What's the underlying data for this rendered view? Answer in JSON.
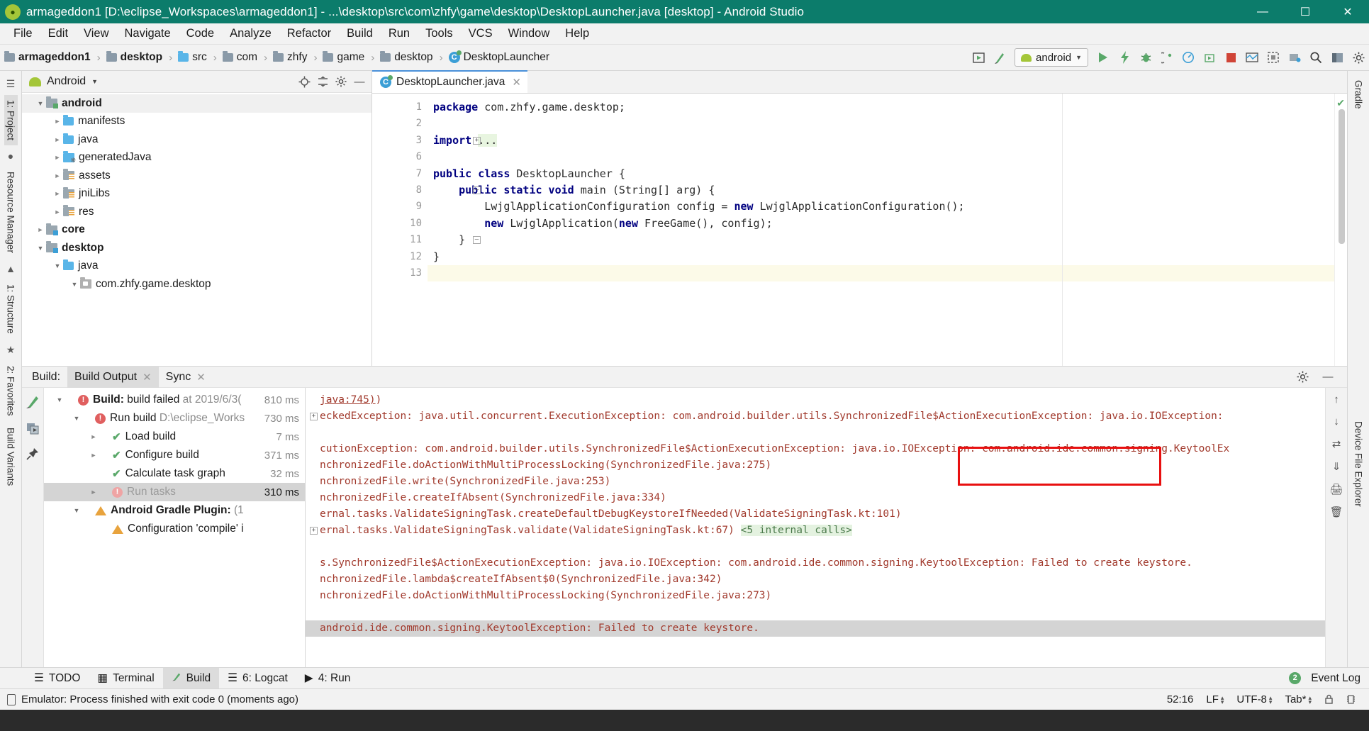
{
  "window": {
    "title": "armageddon1 [D:\\eclipse_Workspaces\\armageddon1] - ...\\desktop\\src\\com\\zhfy\\game\\desktop\\DesktopLauncher.java [desktop] - Android Studio",
    "app_icon": "android-studio-icon",
    "minimize": "—",
    "maximize": "☐",
    "close": "✕"
  },
  "menubar": {
    "items": [
      {
        "label": "File"
      },
      {
        "label": "Edit"
      },
      {
        "label": "View"
      },
      {
        "label": "Navigate"
      },
      {
        "label": "Code"
      },
      {
        "label": "Analyze"
      },
      {
        "label": "Refactor"
      },
      {
        "label": "Build"
      },
      {
        "label": "Run"
      },
      {
        "label": "Tools"
      },
      {
        "label": "VCS"
      },
      {
        "label": "Window"
      },
      {
        "label": "Help"
      }
    ]
  },
  "toolbar": {
    "breadcrumb": [
      {
        "label": "armageddon1",
        "icon": "module-folder-icon",
        "bold": true
      },
      {
        "label": "desktop",
        "icon": "module-folder-icon",
        "bold": true
      },
      {
        "label": "src",
        "icon": "source-folder-icon",
        "bold": false
      },
      {
        "label": "com",
        "icon": "package-folder-icon",
        "bold": false
      },
      {
        "label": "zhfy",
        "icon": "package-folder-icon",
        "bold": false
      },
      {
        "label": "game",
        "icon": "package-folder-icon",
        "bold": false
      },
      {
        "label": "desktop",
        "icon": "package-folder-icon",
        "bold": false
      },
      {
        "label": "DesktopLauncher",
        "icon": "java-class-icon",
        "bold": false
      }
    ],
    "separator": "›",
    "run_config": {
      "label": "android",
      "icon": "android-robot-icon",
      "caret": "▼"
    },
    "icons": [
      "avd-manager-icon",
      "sdk-manager-icon",
      "run-icon",
      "apply-changes-icon",
      "debug-icon",
      "attach-debugger-icon",
      "profiler-icon",
      "run-coverage-icon",
      "stop-icon",
      "layout-inspector-icon",
      "device-screenshot-icon",
      "device-file-explorer-icon",
      "search-icon",
      "project-structure-icon",
      "settings-icon"
    ]
  },
  "left_strip": {
    "tabs": [
      {
        "label": "1: Project",
        "selected": true
      },
      {
        "label": "Resource Manager",
        "selected": false
      },
      {
        "label": "1: Structure",
        "selected": false
      },
      {
        "label": "2: Favorites",
        "selected": false
      },
      {
        "label": "Build Variants",
        "selected": false
      }
    ]
  },
  "right_strip": {
    "tabs": [
      {
        "label": "Gradle"
      },
      {
        "label": "Device File Explorer"
      }
    ]
  },
  "project_panel": {
    "header": {
      "title": "Android",
      "caret": "▼",
      "icon": "android-robot-icon"
    },
    "header_icons": [
      "locate-icon",
      "collapse-all-icon",
      "settings-icon",
      "hide-icon"
    ],
    "tree": [
      {
        "label": "android",
        "depth": 0,
        "arrow": "open",
        "icon": "module-green-icon",
        "bold": true,
        "selected": true
      },
      {
        "label": "manifests",
        "depth": 1,
        "arrow": "closed",
        "icon": "folder-blue-icon",
        "bold": false
      },
      {
        "label": "java",
        "depth": 1,
        "arrow": "closed",
        "icon": "folder-blue-icon",
        "bold": false
      },
      {
        "label": "generatedJava",
        "depth": 1,
        "arrow": "closed",
        "icon": "generated-folder-icon",
        "bold": false
      },
      {
        "label": "assets",
        "depth": 1,
        "arrow": "closed",
        "icon": "resource-folder-icon",
        "bold": false
      },
      {
        "label": "jniLibs",
        "depth": 1,
        "arrow": "closed",
        "icon": "resource-folder-icon",
        "bold": false
      },
      {
        "label": "res",
        "depth": 1,
        "arrow": "closed",
        "icon": "resource-folder-icon",
        "bold": false
      },
      {
        "label": "core",
        "depth": 0,
        "arrow": "closed",
        "icon": "module-blue-icon",
        "bold": true
      },
      {
        "label": "desktop",
        "depth": 0,
        "arrow": "open",
        "icon": "module-blue-icon",
        "bold": true
      },
      {
        "label": "java",
        "depth": 1,
        "arrow": "open",
        "icon": "folder-blue-icon",
        "bold": false
      },
      {
        "label": "com.zhfy.game.desktop",
        "depth": 2,
        "arrow": "open",
        "icon": "package-icon",
        "bold": false
      }
    ]
  },
  "editor": {
    "tab": {
      "label": "DesktopLauncher.java",
      "icon": "java-class-icon",
      "close": "✕"
    },
    "lines": [
      {
        "num": "1",
        "text": "package com.zhfy.game.desktop;",
        "kw": "package",
        "run_marker": false,
        "fold": ""
      },
      {
        "num": "2",
        "text": "",
        "kw": "",
        "run_marker": false,
        "fold": ""
      },
      {
        "num": "3",
        "text": "import ...",
        "kw": "import",
        "run_marker": false,
        "fold": "+"
      },
      {
        "num": "6",
        "text": "",
        "kw": "",
        "run_marker": false,
        "fold": ""
      },
      {
        "num": "7",
        "text": "public class DesktopLauncher {",
        "kw": "public class",
        "run_marker": true,
        "fold": ""
      },
      {
        "num": "8",
        "text": "    public static void main (String[] arg) {",
        "kw": "public static void",
        "run_marker": true,
        "fold": "-"
      },
      {
        "num": "9",
        "text": "        LwjglApplicationConfiguration config = new LwjglApplicationConfiguration();",
        "kw": "new",
        "run_marker": false,
        "fold": ""
      },
      {
        "num": "10",
        "text": "        new LwjglApplication(new FreeGame(), config);",
        "kw": "new",
        "run_marker": false,
        "fold": ""
      },
      {
        "num": "11",
        "text": "    }",
        "kw": "",
        "run_marker": false,
        "fold": ""
      },
      {
        "num": "12",
        "text": "}",
        "kw": "",
        "run_marker": false,
        "fold": ""
      },
      {
        "num": "13",
        "text": "",
        "kw": "",
        "run_marker": false,
        "fold": "",
        "current": true
      }
    ],
    "inspection_status": "✔"
  },
  "build_panel": {
    "label": "Build:",
    "tabs": [
      {
        "label": "Build Output",
        "selected": true,
        "close": "✕"
      },
      {
        "label": "Sync",
        "selected": false,
        "close": "✕"
      }
    ],
    "header_icons": [
      "settings-icon",
      "hide-icon"
    ],
    "tool_icons": [
      "build-hammer-icon",
      "restart-icon",
      "pin-icon"
    ],
    "tree": [
      {
        "label": "Build:",
        "label2": "build failed",
        "detail": "at 2019/6/3(",
        "ms": "810 ms",
        "depth": 0,
        "arrow": "open",
        "status": "error",
        "bold": true
      },
      {
        "label": "Run build",
        "label2": "",
        "detail": "D:\\eclipse_Worksр",
        "ms": "730 ms",
        "depth": 1,
        "arrow": "open",
        "status": "error",
        "bold": false
      },
      {
        "label": "Load build",
        "label2": "",
        "detail": "",
        "ms": "7 ms",
        "depth": 2,
        "arrow": "closed",
        "status": "ok",
        "bold": false
      },
      {
        "label": "Configure build",
        "label2": "",
        "detail": "",
        "ms": "371 ms",
        "depth": 2,
        "arrow": "closed",
        "status": "ok",
        "bold": false
      },
      {
        "label": "Calculate task graph",
        "label2": "",
        "detail": "",
        "ms": "32 ms",
        "depth": 2,
        "arrow": "none",
        "status": "ok",
        "bold": false
      },
      {
        "label": "Run tasks",
        "label2": "",
        "detail": "",
        "ms": "310 ms",
        "depth": 2,
        "arrow": "closed",
        "status": "error",
        "bold": false,
        "selected": true
      },
      {
        "label": "Android Gradle Plugin:",
        "label2": "",
        "detail": "(1",
        "ms": "",
        "depth": 1,
        "arrow": "open",
        "status": "warn",
        "bold": true
      },
      {
        "label": "Configuration 'compile' i",
        "label2": "",
        "detail": "",
        "ms": "",
        "depth": 2,
        "arrow": "none",
        "status": "warn",
        "bold": false
      }
    ],
    "console": [
      {
        "text": "java:745)",
        "link": true,
        "expander": ""
      },
      {
        "text": "eckedException: java.util.concurrent.ExecutionException: com.android.builder.utils.SynchronizedFile$ActionExecutionException: java.io.IOException:",
        "expander": "+"
      },
      {
        "text": "",
        "expander": ""
      },
      {
        "text": "cutionException: com.android.builder.utils.SynchronizedFile$ActionExecutionException: java.io.IOException: com.android.ide.common.signing.KeytoolEx",
        "expander": ""
      },
      {
        "text": "nchronizedFile.doActionWithMultiProcessLocking(SynchronizedFile.java:275)",
        "expander": ""
      },
      {
        "text": "nchronizedFile.write(SynchronizedFile.java:253)",
        "expander": ""
      },
      {
        "text": "nchronizedFile.createIfAbsent(SynchronizedFile.java:334)",
        "expander": ""
      },
      {
        "text": "ernal.tasks.ValidateSigningTask.createDefaultDebugKeystoreIfNeeded(ValidateSigningTask.kt:101)",
        "expander": ""
      },
      {
        "text": "ernal.tasks.ValidateSigningTask.validate(ValidateSigningTask.kt:67)",
        "suffix": "<5 internal calls>",
        "expander": "+"
      },
      {
        "text": "",
        "expander": ""
      },
      {
        "text": "s.SynchronizedFile$ActionExecutionException: java.io.IOException: com.android.ide.common.signing.KeytoolException: Failed to create keystore.",
        "expander": ""
      },
      {
        "text": "nchronizedFile.lambda$createIfAbsent$0(SynchronizedFile.java:342)",
        "expander": ""
      },
      {
        "text": "nchronizedFile.doActionWithMultiProcessLocking(SynchronizedFile.java:273)",
        "expander": ""
      },
      {
        "text": "",
        "expander": ""
      },
      {
        "text": "android.ide.common.signing.KeytoolException: Failed to create keystore.",
        "selected": true,
        "expander": ""
      }
    ],
    "highlight_box_color": "#e81010",
    "console_tool_icons": [
      "up-icon",
      "down-icon",
      "wrap-icon",
      "soft-wrap-icon",
      "print-icon",
      "trash-icon"
    ]
  },
  "bottom_bar": {
    "tabs": [
      {
        "label": "TODO",
        "icon": "todo-icon",
        "selected": false
      },
      {
        "label": "Terminal",
        "icon": "terminal-icon",
        "selected": false
      },
      {
        "label": "Build",
        "icon": "build-hammer-icon",
        "selected": true
      },
      {
        "label": "6: Logcat",
        "icon": "logcat-icon",
        "selected": false
      },
      {
        "label": "4: Run",
        "icon": "run-icon",
        "selected": false
      }
    ],
    "event_log": {
      "label": "Event Log",
      "count": "2"
    }
  },
  "status_bar": {
    "message": "Emulator: Process finished with exit code 0 (moments ago)",
    "caret_position": "52:16",
    "line_separator": "LF",
    "encoding": "UTF-8",
    "indent": "Tab*",
    "icons": [
      "lock-icon",
      "memory-icon"
    ]
  }
}
